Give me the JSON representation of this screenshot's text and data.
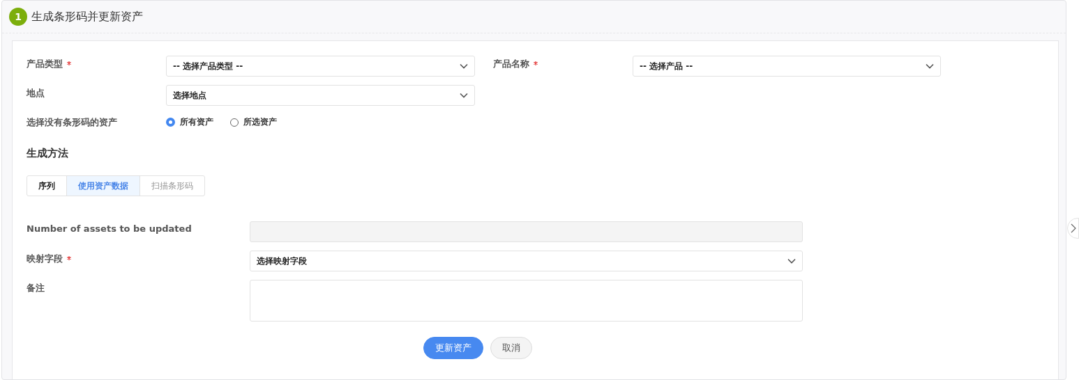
{
  "panel": {
    "step": "1",
    "title": "生成条形码并更新资产"
  },
  "top_rows": [
    [
      {
        "label": "产品类型",
        "required": true,
        "value": "-- 选择产品类型 --"
      },
      {
        "label": "产品名称",
        "required": true,
        "value": "-- 选择产品 --"
      }
    ],
    [
      {
        "label": "地点",
        "required": false,
        "value": "选择地点"
      }
    ]
  ],
  "asset_scope": {
    "label": "选择没有条形码的资产",
    "options": [
      {
        "label": "所有资产",
        "selected": true
      },
      {
        "label": "所选资产",
        "selected": false
      }
    ]
  },
  "method": {
    "heading": "生成方法",
    "tabs": [
      {
        "label": "序列",
        "selected": false,
        "disabled": false
      },
      {
        "label": "使用资产数据",
        "selected": true,
        "disabled": false
      },
      {
        "label": "扫描条形码",
        "selected": false,
        "disabled": true
      }
    ]
  },
  "fields": [
    {
      "label": "Number of assets to be updated",
      "required": false,
      "kind": "readonly"
    },
    {
      "label": "映射字段",
      "required": true,
      "kind": "select",
      "value": "选择映射字段"
    },
    {
      "label": "备注",
      "required": false,
      "kind": "textarea"
    }
  ],
  "buttons": [
    {
      "label": "更新资产",
      "kind": "primary"
    },
    {
      "label": "取消",
      "kind": "secondary"
    }
  ]
}
